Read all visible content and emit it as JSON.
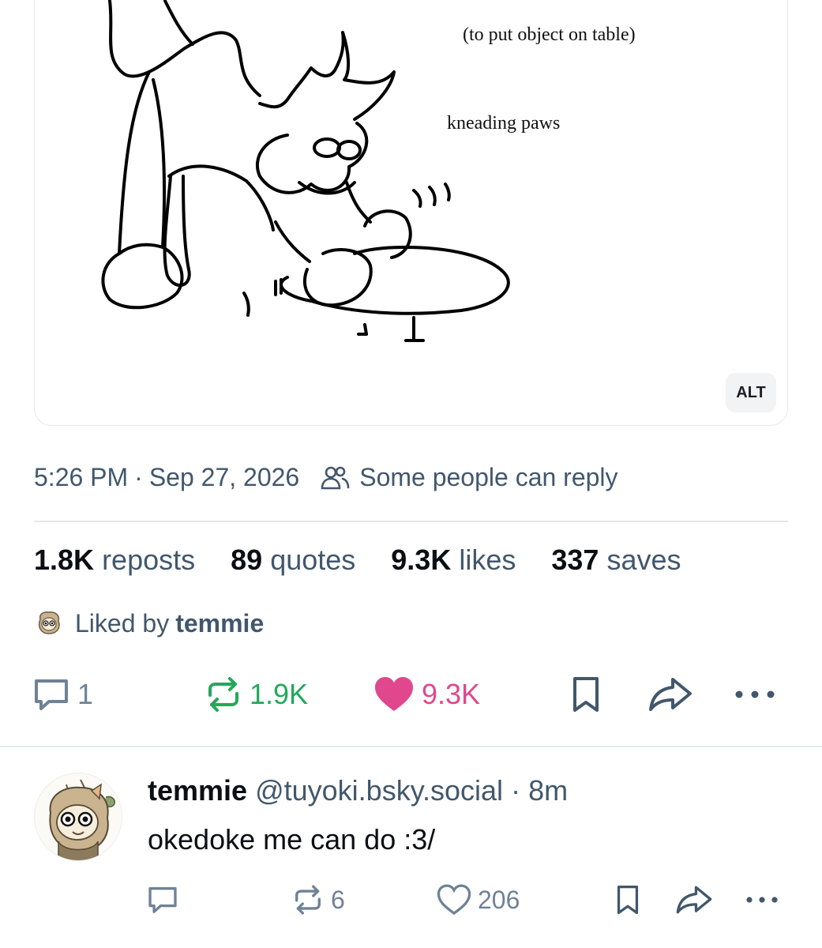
{
  "image": {
    "caption_table": "(to put object on table)",
    "caption_paws": "kneading paws",
    "alt_badge": "ALT"
  },
  "post": {
    "time": "5:26 PM",
    "separator": "·",
    "date": "Sep 27, 2026",
    "reply_setting": "Some people can reply",
    "stats": {
      "reposts_count": "1.8K",
      "reposts_label": "reposts",
      "quotes_count": "89",
      "quotes_label": "quotes",
      "likes_count": "9.3K",
      "likes_label": "likes",
      "saves_count": "337",
      "saves_label": "saves"
    },
    "liked_by_prefix": "Liked by",
    "liked_by_name": "temmie",
    "actions": {
      "reply_count": "1",
      "repost_count": "1.9K",
      "like_count": "9.3K"
    }
  },
  "reply": {
    "display_name": "temmie",
    "handle": "@tuyoki.bsky.social",
    "separator": "·",
    "age": "8m",
    "text": "okedoke me can do :3/",
    "actions": {
      "repost_count": "6",
      "like_count": "206"
    }
  },
  "colors": {
    "repost_active": "#22a85a",
    "like_active": "#e0478c",
    "muted": "#42576c",
    "icon": "#6f8296"
  },
  "icons": [
    "reply-bubble-icon",
    "repost-icon",
    "heart-icon",
    "bookmark-icon",
    "share-arrow-icon",
    "more-dots-icon",
    "people-icon"
  ]
}
